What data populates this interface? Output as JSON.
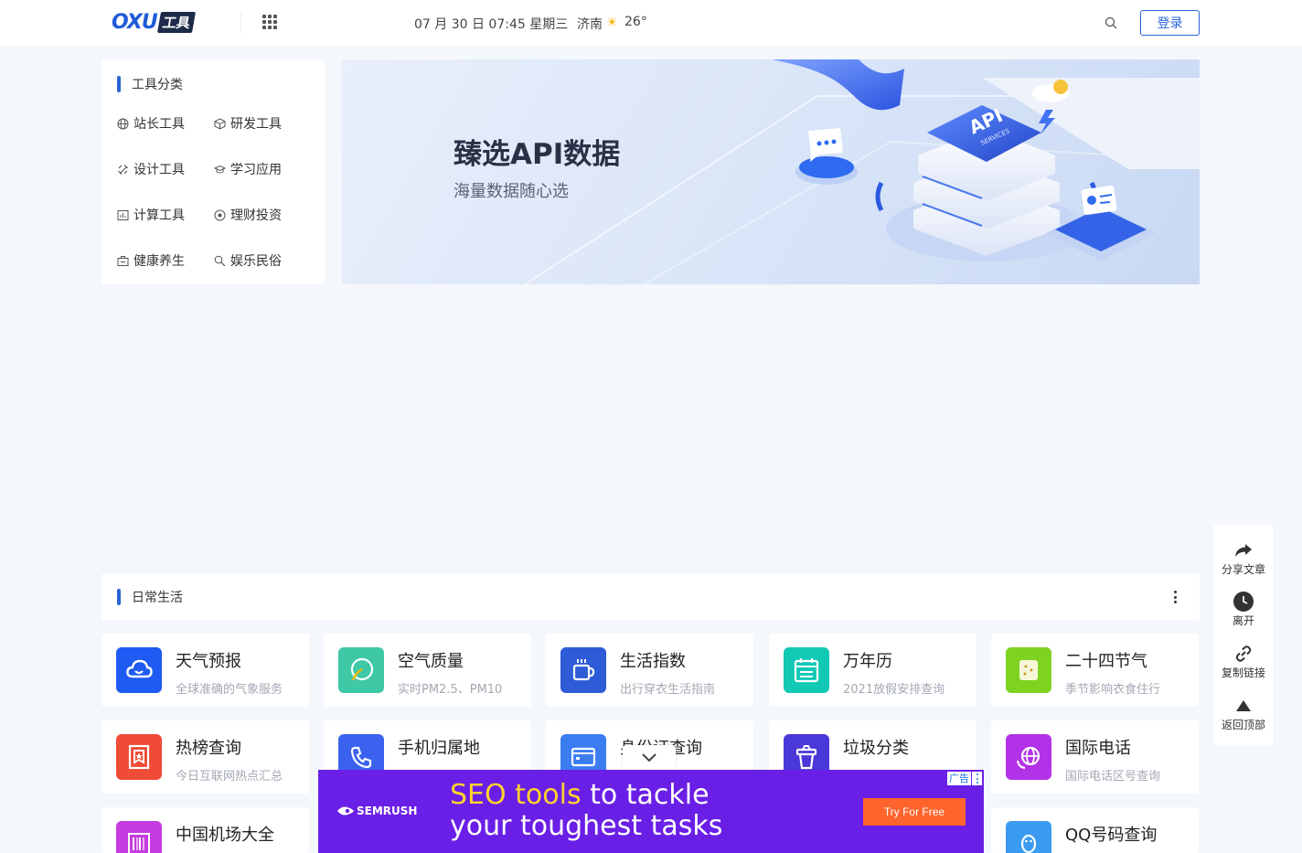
{
  "header": {
    "logo_text": "OXU",
    "logo_badge": "工具",
    "date": "07 月 30 日 07:45 星期三",
    "city": "济南",
    "weather_icon": "sun-icon",
    "temperature": "26°",
    "login_label": "登录"
  },
  "categories": {
    "title": "工具分类",
    "items": [
      {
        "label": "站长工具",
        "icon": "globe-icon"
      },
      {
        "label": "研发工具",
        "icon": "cube-icon"
      },
      {
        "label": "设计工具",
        "icon": "palette-icon"
      },
      {
        "label": "学习应用",
        "icon": "graduation-cap-icon"
      },
      {
        "label": "计算工具",
        "icon": "bar-chart-icon"
      },
      {
        "label": "理财投资",
        "icon": "target-icon"
      },
      {
        "label": "健康养生",
        "icon": "medkit-icon"
      },
      {
        "label": "娱乐民俗",
        "icon": "magnifier-icon"
      }
    ]
  },
  "banner": {
    "title": "臻选API数据",
    "subtitle": "海量数据随心选",
    "chip_line1": "API",
    "chip_line2": "SERVICES"
  },
  "life": {
    "title": "日常生活",
    "tools": [
      {
        "name": "天气预报",
        "desc": "全球准确的气象服务",
        "icon": "cloud-icon",
        "color": "#1f5bf2"
      },
      {
        "name": "空气质量",
        "desc": "实时PM2.5、PM10",
        "icon": "leaf-icon",
        "color": "#3ec8a6"
      },
      {
        "name": "生活指数",
        "desc": "出行穿衣生活指南",
        "icon": "cup-icon",
        "color": "#2e5bd6"
      },
      {
        "name": "万年历",
        "desc": "2021放假安排查询",
        "icon": "calendar-icon",
        "color": "#12c9b5"
      },
      {
        "name": "二十四节气",
        "desc": "季节影响衣食住行",
        "icon": "season-icon",
        "color": "#7ed321"
      },
      {
        "name": "热榜查询",
        "desc": "今日互联网热点汇总",
        "icon": "bookmark-star-icon",
        "color": "#ef4b36"
      },
      {
        "name": "手机归属地",
        "desc": "",
        "icon": "phone-icon",
        "color": "#3b62ef"
      },
      {
        "name": "身份证查询",
        "desc": "",
        "icon": "id-card-icon",
        "color": "#3b7cf0"
      },
      {
        "name": "垃圾分类",
        "desc": "",
        "icon": "trash-icon",
        "color": "#4a39d8"
      },
      {
        "name": "国际电话",
        "desc": "国际电话区号查询",
        "icon": "globe-phone-icon",
        "color": "#b232e8"
      },
      {
        "name": "中国机场大全",
        "desc": "",
        "icon": "barcode-icon",
        "color": "#c63be0"
      },
      {
        "name": "QQ号码查询",
        "desc": "",
        "icon": "penguin-icon",
        "color": "#3a9bf0"
      }
    ]
  },
  "side": {
    "share": "分享文章",
    "leave": "离开",
    "copy_link": "复制链接",
    "back_top": "返回顶部"
  },
  "ad": {
    "brand": "SEMRUSH",
    "line1_highlight": "SEO tools",
    "line1_rest": " to tackle",
    "line2": "your toughest tasks",
    "cta": "Try For Free",
    "tag": "广告"
  }
}
